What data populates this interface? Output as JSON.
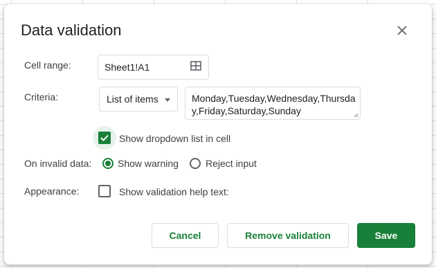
{
  "dialog": {
    "title": "Data validation",
    "close_icon": "close-icon"
  },
  "cell_range": {
    "label": "Cell range:",
    "value": "Sheet1!A1",
    "icon": "grid-select-icon"
  },
  "criteria": {
    "label": "Criteria:",
    "type_selected": "List of items",
    "items_value": "Monday,Tuesday,Wednesday,Thursday,Friday,Saturday,Sunday"
  },
  "dropdown_option": {
    "label": "Show dropdown list in cell",
    "checked": true
  },
  "invalid_data": {
    "label": "On invalid data:",
    "options": [
      {
        "label": "Show warning",
        "selected": true
      },
      {
        "label": "Reject input",
        "selected": false
      }
    ]
  },
  "appearance": {
    "label": "Appearance:",
    "help_text_label": "Show validation help text:",
    "checked": false
  },
  "buttons": {
    "cancel": "Cancel",
    "remove": "Remove validation",
    "save": "Save"
  },
  "colors": {
    "accent": "#188038",
    "border": "#dadce0",
    "text": "#202124"
  }
}
